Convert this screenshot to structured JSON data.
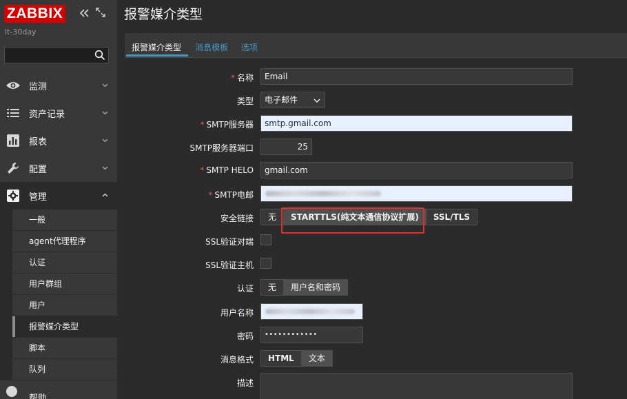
{
  "app": {
    "logo_text": "ZABBIX",
    "server_name": "lt-30day",
    "page_title": "报警媒介类型",
    "brand_color": "#d40000",
    "accent_color": "#4796c4"
  },
  "search": {
    "value": "",
    "icon": "search-icon"
  },
  "sidebar": {
    "menu": [
      {
        "label": "监测",
        "icon": "eye-icon"
      },
      {
        "label": "资产记录",
        "icon": "list-icon"
      },
      {
        "label": "报表",
        "icon": "bar-chart-icon"
      },
      {
        "label": "配置",
        "icon": "wrench-icon"
      },
      {
        "label": "管理",
        "icon": "gear-icon"
      }
    ],
    "admin_submenu": [
      "一般",
      "agent代理程序",
      "认证",
      "用户群组",
      "用户",
      "报警媒介类型",
      "脚本",
      "队列"
    ],
    "selected_submenu": "报警媒介类型",
    "bottom_item": "帮助"
  },
  "tabs": [
    "报警媒介类型",
    "消息模板",
    "选项"
  ],
  "form": {
    "name": {
      "label": "名称",
      "value": "Email"
    },
    "type": {
      "label": "类型",
      "value": "电子邮件"
    },
    "smtp_server": {
      "label": "SMTP服务器",
      "value": "smtp.gmail.com"
    },
    "smtp_port": {
      "label": "SMTP服务器端口",
      "value": "25"
    },
    "smtp_helo": {
      "label": "SMTP HELO",
      "value": "gmail.com"
    },
    "smtp_email": {
      "label": "SMTP电邮",
      "value": ""
    },
    "security": {
      "label": "安全链接",
      "options": [
        "无",
        "STARTTLS(纯文本通信协议扩展)",
        "SSL/TLS"
      ],
      "selected": "STARTTLS(纯文本通信协议扩展)"
    },
    "ssl_verify_peer": {
      "label": "SSL验证对端",
      "checked": false
    },
    "ssl_verify_host": {
      "label": "SSL验证主机",
      "checked": false
    },
    "auth": {
      "label": "认证",
      "options": [
        "无",
        "用户名和密码"
      ],
      "selected": "用户名和密码"
    },
    "username": {
      "label": "用户名称",
      "value": ""
    },
    "password": {
      "label": "密码",
      "value": "••••••••••••"
    },
    "message_format": {
      "label": "消息格式",
      "options": [
        "HTML",
        "文本"
      ],
      "selected": "文本"
    },
    "description": {
      "label": "描述",
      "value": ""
    },
    "required_marker": "*"
  }
}
